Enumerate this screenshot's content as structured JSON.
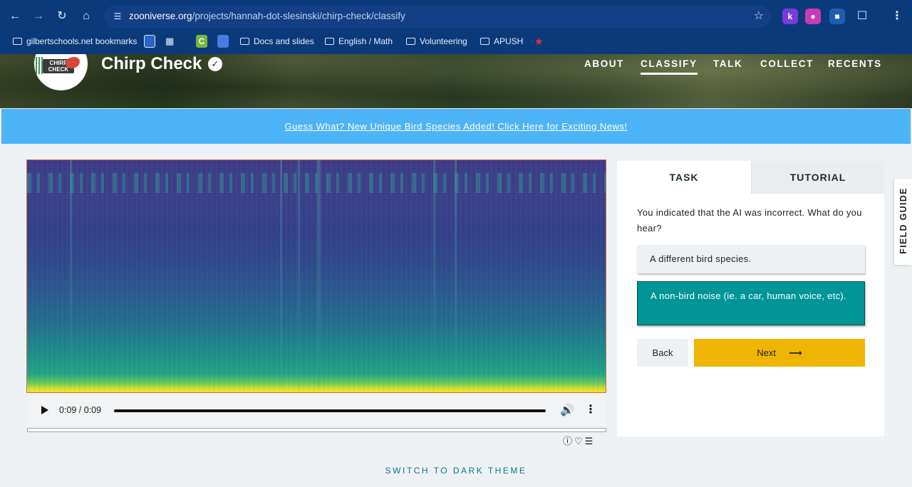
{
  "browser": {
    "url_host": "zooniverse.org",
    "url_path": "/projects/hannah-dot-slesinski/chirp-check/classify",
    "bookmarks": [
      {
        "label": "gilbertschools.net bookmarks"
      },
      {
        "label": "Docs and slides"
      },
      {
        "label": "English / Math"
      },
      {
        "label": "Volunteering"
      },
      {
        "label": "APUSH"
      }
    ]
  },
  "project": {
    "logo_text": "CHIRP CHECK",
    "title": "Chirp Check",
    "nav": [
      "ABOUT",
      "CLASSIFY",
      "TALK",
      "COLLECT",
      "RECENTS"
    ],
    "active_nav": "CLASSIFY"
  },
  "banner": {
    "text": "Guess What? New Unique Bird Species Added! Click Here for Exciting News!"
  },
  "player": {
    "time": "0:09 / 0:09"
  },
  "task_panel": {
    "tabs": [
      "TASK",
      "TUTORIAL"
    ],
    "question": "You indicated that the AI was incorrect. What do you hear?",
    "answers": [
      "A different bird species.",
      "A non-bird noise (ie. a car, human voice, etc)."
    ],
    "selected_answer": 1,
    "back_label": "Back",
    "next_label": "Next"
  },
  "field_guide_label": "FIELD GUIDE",
  "theme_toggle_label": "SWITCH TO DARK THEME",
  "colors": {
    "chrome_bg": "#0b3a7a",
    "banner_bg": "#4cb3f7",
    "selected_answer_bg": "#029597",
    "next_button_bg": "#efb503",
    "theme_link": "#007c89"
  }
}
